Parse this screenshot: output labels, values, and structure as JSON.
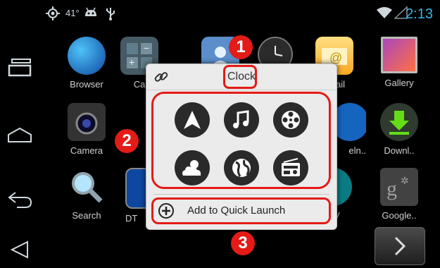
{
  "status_bar": {
    "temperature": "41°",
    "time": "2:13",
    "icons": [
      "gps-icon",
      "android-icon",
      "usb-icon",
      "wifi-icon",
      "signal-icon"
    ]
  },
  "nav_bar": {
    "buttons": [
      "recent-apps-icon",
      "home-icon",
      "back-icon",
      "menu-icon"
    ]
  },
  "apps": [
    {
      "label": "Browser",
      "icon": "globe-icon"
    },
    {
      "label": "Ca",
      "icon": "calculator-icon"
    },
    {
      "label": "",
      "icon": "contacts-icon"
    },
    {
      "label": "",
      "icon": "clock-icon"
    },
    {
      "label": "ail",
      "icon": "email-icon"
    },
    {
      "label": "Gallery",
      "icon": "gallery-icon"
    },
    {
      "label": "Camera",
      "icon": "camera-icon"
    },
    {
      "label": "eln..",
      "icon": "help-icon"
    },
    {
      "label": "Downl..",
      "icon": "download-icon"
    },
    {
      "label": "Search",
      "icon": "search-icon"
    },
    {
      "label": "DT",
      "icon": "tv-icon"
    },
    {
      "label": "V",
      "icon": "play-store-icon"
    },
    {
      "label": "Google..",
      "icon": "google-settings-icon"
    }
  ],
  "popup": {
    "title": "Clock",
    "quick_apps": [
      "navigation-icon",
      "music-icon",
      "film-reel-icon",
      "weather-icon",
      "globe-icon",
      "radio-icon"
    ],
    "add_label": "Add to Quick Launch"
  },
  "annotations": {
    "badge_1": "1",
    "badge_2": "2",
    "badge_3": "3",
    "color": "#e41b17"
  }
}
